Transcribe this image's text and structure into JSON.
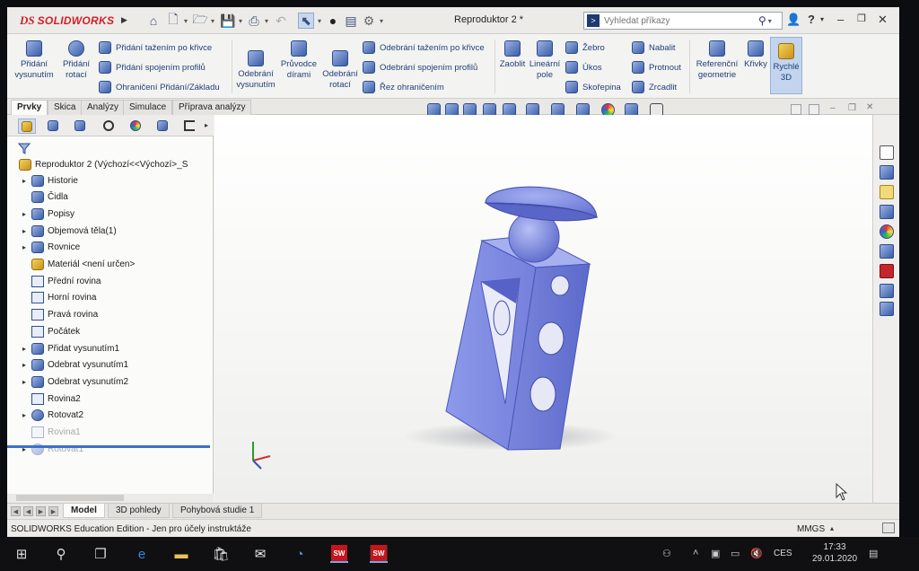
{
  "titlebar": {
    "brand_prefix": "DS",
    "brand_name": "SOLIDWORKS",
    "document_title": "Reproduktor 2 *",
    "search_placeholder": "Vyhledat příkazy",
    "help_label": "?"
  },
  "ribbon": {
    "extrude_boss": "Přidání vysunutím",
    "revolve_boss": "Přidání rotací",
    "swept_boss": "Přidání tažením po křivce",
    "lofted_boss": "Přidání spojením profilů",
    "boundary_boss": "Ohraničení Přidání/Základu",
    "extrude_cut": "Odebrání vysunutím",
    "hole_wizard": "Průvodce dírami",
    "revolve_cut": "Odebrání rotací",
    "swept_cut": "Odebrání tažením po křivce",
    "lofted_cut": "Odebrání spojením profilů",
    "boundary_cut": "Řez ohraničením",
    "fillet": "Zaoblit",
    "linear_pattern": "Lineární pole",
    "rib": "Žebro",
    "draft": "Úkos",
    "shell": "Skořepina",
    "wrap": "Nabalit",
    "intersect": "Protnout",
    "mirror": "Zrcadlit",
    "reference_geometry": "Referenční geometrie",
    "curves": "Křivky",
    "instant3d": "Rychlé 3D"
  },
  "tabs": [
    "Prvky",
    "Skica",
    "Analýzy",
    "Simulace",
    "Příprava analýzy"
  ],
  "tree": {
    "root": "Reproduktor 2  (Výchozí<<Výchozí>_S",
    "items": [
      {
        "label": "Historie",
        "expandable": true
      },
      {
        "label": "Čidla",
        "expandable": false
      },
      {
        "label": "Popisy",
        "expandable": true
      },
      {
        "label": "Objemová těla(1)",
        "expandable": true
      },
      {
        "label": "Rovnice",
        "expandable": true
      },
      {
        "label": "Materiál <není určen>",
        "expandable": false
      },
      {
        "label": "Přední rovina",
        "expandable": false
      },
      {
        "label": "Horní rovina",
        "expandable": false
      },
      {
        "label": "Pravá rovina",
        "expandable": false
      },
      {
        "label": "Počátek",
        "expandable": false
      },
      {
        "label": "Přidat vysunutím1",
        "expandable": true
      },
      {
        "label": "Odebrat vysunutím1",
        "expandable": true
      },
      {
        "label": "Odebrat vysunutím2",
        "expandable": true
      },
      {
        "label": "Rovina2",
        "expandable": false
      },
      {
        "label": "Rotovat2",
        "expandable": true
      },
      {
        "label": "Rovina1",
        "expandable": false
      },
      {
        "label": "Rotovat1",
        "expandable": true
      }
    ]
  },
  "bottom_tabs": [
    "Model",
    "3D pohledy",
    "Pohybová studie 1"
  ],
  "status": {
    "edition": "SOLIDWORKS Education Edition - Jen pro účely instruktáže",
    "units": "MMGS"
  },
  "taskbar": {
    "app_badge": "SW",
    "language": "CES",
    "time": "17:33",
    "date": "29.01.2020"
  },
  "colors": {
    "model_face": "#6f7cd8",
    "model_side": "#8a96e6",
    "brand": "#d0202a",
    "accent": "#3a6fd0"
  }
}
